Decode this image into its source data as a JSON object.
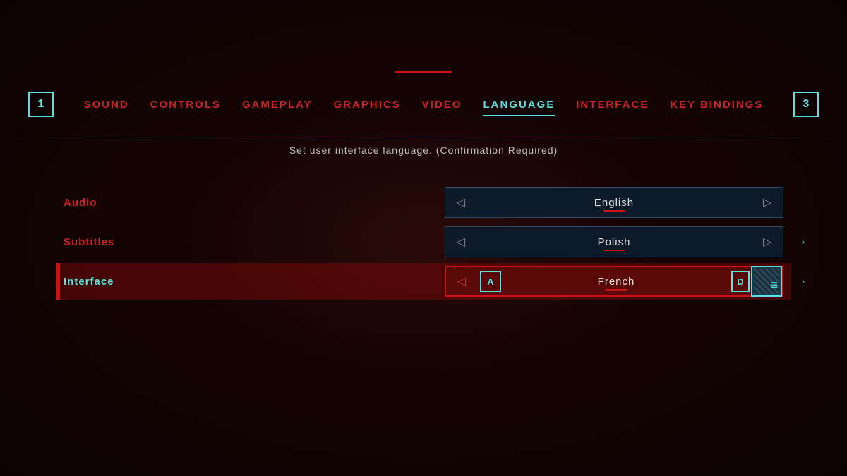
{
  "nav": {
    "left_btn": "1",
    "right_btn": "3",
    "tabs": [
      {
        "id": "sound",
        "label": "SOUND",
        "active": false
      },
      {
        "id": "controls",
        "label": "CONTROLS",
        "active": false
      },
      {
        "id": "gameplay",
        "label": "GAMEPLAY",
        "active": false
      },
      {
        "id": "graphics",
        "label": "GRAPHICS",
        "active": false
      },
      {
        "id": "video",
        "label": "VIDEO",
        "active": false
      },
      {
        "id": "language",
        "label": "LANGUAGE",
        "active": true
      },
      {
        "id": "interface",
        "label": "INTERFACE",
        "active": false
      },
      {
        "id": "keybindings",
        "label": "KEY BINDINGS",
        "active": false
      }
    ]
  },
  "description": "Set user interface language. (Confirmation Required)",
  "settings": [
    {
      "id": "audio",
      "label": "Audio",
      "value": "English",
      "highlighted": false,
      "gamepad_left": null,
      "gamepad_right": null
    },
    {
      "id": "subtitles",
      "label": "Subtitles",
      "value": "Polish",
      "highlighted": false,
      "gamepad_left": null,
      "gamepad_right": null
    },
    {
      "id": "interface",
      "label": "Interface",
      "value": "French",
      "highlighted": true,
      "gamepad_left": "A",
      "gamepad_right": "D"
    }
  ],
  "colors": {
    "accent_red": "#cc2222",
    "accent_teal": "#5ae0e0",
    "bg_dark": "#1a0505"
  }
}
